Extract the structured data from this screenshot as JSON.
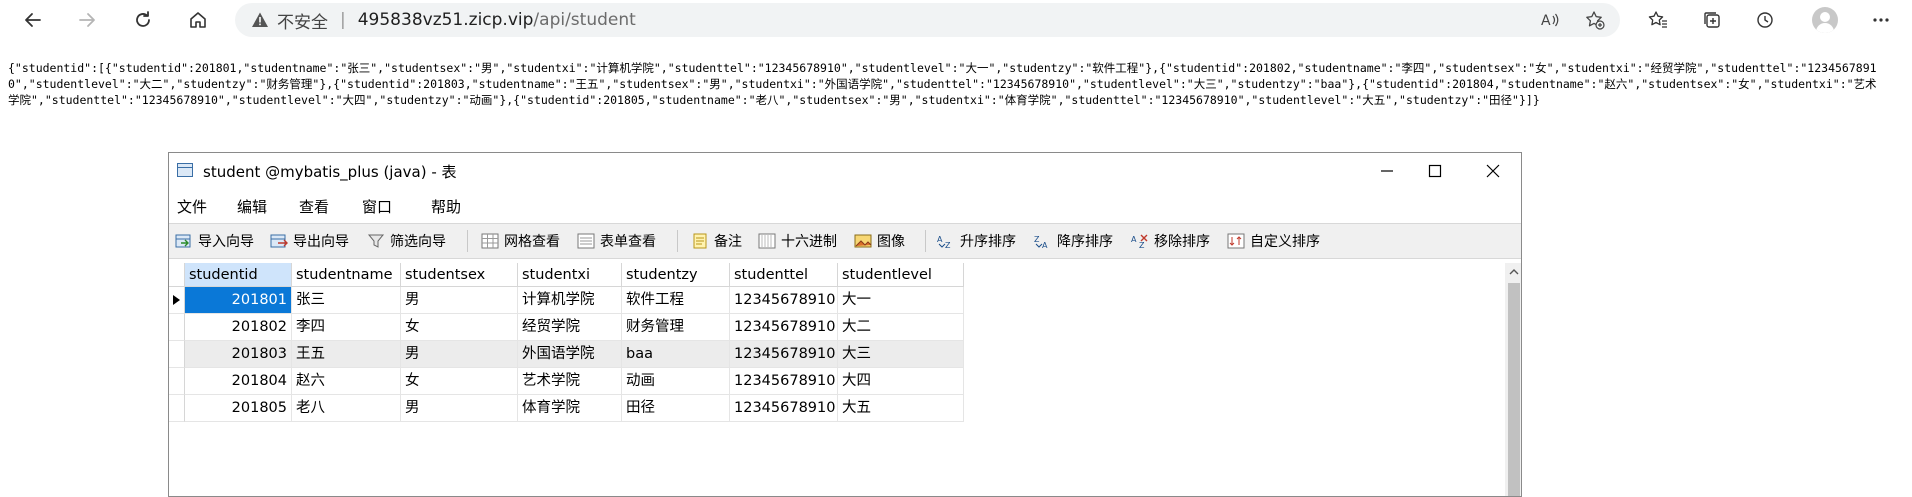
{
  "browser": {
    "security_label": "不安全",
    "separator": "|",
    "url_host": "495838vz51.zicp.vip",
    "url_path": "/api/student"
  },
  "json_text": "{\"studentid\":[{\"studentid\":201801,\"studentname\":\"张三\",\"studentsex\":\"男\",\"studentxi\":\"计算机学院\",\"studenttel\":\"12345678910\",\"studentlevel\":\"大一\",\"studentzy\":\"软件工程\"},{\"studentid\":201802,\"studentname\":\"李四\",\"studentsex\":\"女\",\"studentxi\":\"经贸学院\",\"studenttel\":\"12345678910\",\"studentlevel\":\"大二\",\"studentzy\":\"财务管理\"},{\"studentid\":201803,\"studentname\":\"王五\",\"studentsex\":\"男\",\"studentxi\":\"外国语学院\",\"studenttel\":\"12345678910\",\"studentlevel\":\"大三\",\"studentzy\":\"baa\"},{\"studentid\":201804,\"studentname\":\"赵六\",\"studentsex\":\"女\",\"studentxi\":\"艺术学院\",\"studenttel\":\"12345678910\",\"studentlevel\":\"大四\",\"studentzy\":\"动画\"},{\"studentid\":201805,\"studentname\":\"老八\",\"studentsex\":\"男\",\"studentxi\":\"体育学院\",\"studenttel\":\"12345678910\",\"studentlevel\":\"大五\",\"studentzy\":\"田径\"}]}",
  "window": {
    "title": "student @mybatis_plus (java) - 表",
    "menu": [
      "文件",
      "编辑",
      "查看",
      "窗口",
      "帮助"
    ],
    "toolbar": [
      "导入向导",
      "导出向导",
      "筛选向导",
      "网格查看",
      "表单查看",
      "备注",
      "十六进制",
      "图像",
      "升序排序",
      "降序排序",
      "移除排序",
      "自定义排序"
    ]
  },
  "table": {
    "columns": [
      "studentid",
      "studentname",
      "studentsex",
      "studentxi",
      "studentzy",
      "studenttel",
      "studentlevel"
    ],
    "rows": [
      [
        "201801",
        "张三",
        "男",
        "计算机学院",
        "软件工程",
        "12345678910",
        "大一"
      ],
      [
        "201802",
        "李四",
        "女",
        "经贸学院",
        "财务管理",
        "12345678910",
        "大二"
      ],
      [
        "201803",
        "王五",
        "男",
        "外国语学院",
        "baa",
        "12345678910",
        "大三"
      ],
      [
        "201804",
        "赵六",
        "女",
        "艺术学院",
        "动画",
        "12345678910",
        "大四"
      ],
      [
        "201805",
        "老八",
        "男",
        "体育学院",
        "田径",
        "12345678910",
        "大五"
      ]
    ],
    "selected_row": 0,
    "highlighted_row": 2
  }
}
